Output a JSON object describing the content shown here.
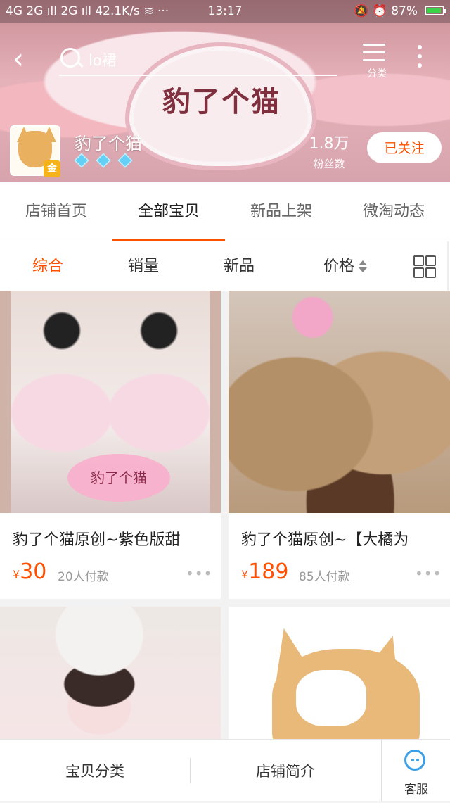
{
  "status_bar": {
    "left": "4G 2G ıll 2G ıll 42.1K/s ≋ ···",
    "time": "13:17",
    "right": "🔕 ⏰ 87%"
  },
  "header": {
    "back": "‹",
    "search_value": "lo裙",
    "category_label": "分类",
    "banner_text": "豹了个猫"
  },
  "shop": {
    "name": "豹了个猫",
    "badge": "金",
    "fans_count": "1.8万",
    "fans_label": "粉丝数",
    "follow_button": "已关注"
  },
  "shop_tabs": [
    {
      "label": "店铺首页"
    },
    {
      "label": "全部宝贝"
    },
    {
      "label": "新品上架"
    },
    {
      "label": "微淘动态"
    }
  ],
  "sort_bar": {
    "items": [
      {
        "label": "综合"
      },
      {
        "label": "销量"
      },
      {
        "label": "新品"
      },
      {
        "label": "价格"
      }
    ]
  },
  "products": [
    {
      "title": "豹了个猫原创~紫色版甜",
      "currency": "¥",
      "price": "30",
      "paid": "20人付款",
      "stamp": "豹了个猫"
    },
    {
      "title": "豹了个猫原创~【大橘为",
      "currency": "¥",
      "price": "189",
      "paid": "85人付款"
    }
  ],
  "bottom_bar": {
    "category": "宝贝分类",
    "intro": "店铺简介",
    "service": "客服"
  },
  "colors": {
    "accent": "#ff5000",
    "service_blue": "#3aa0e8"
  }
}
